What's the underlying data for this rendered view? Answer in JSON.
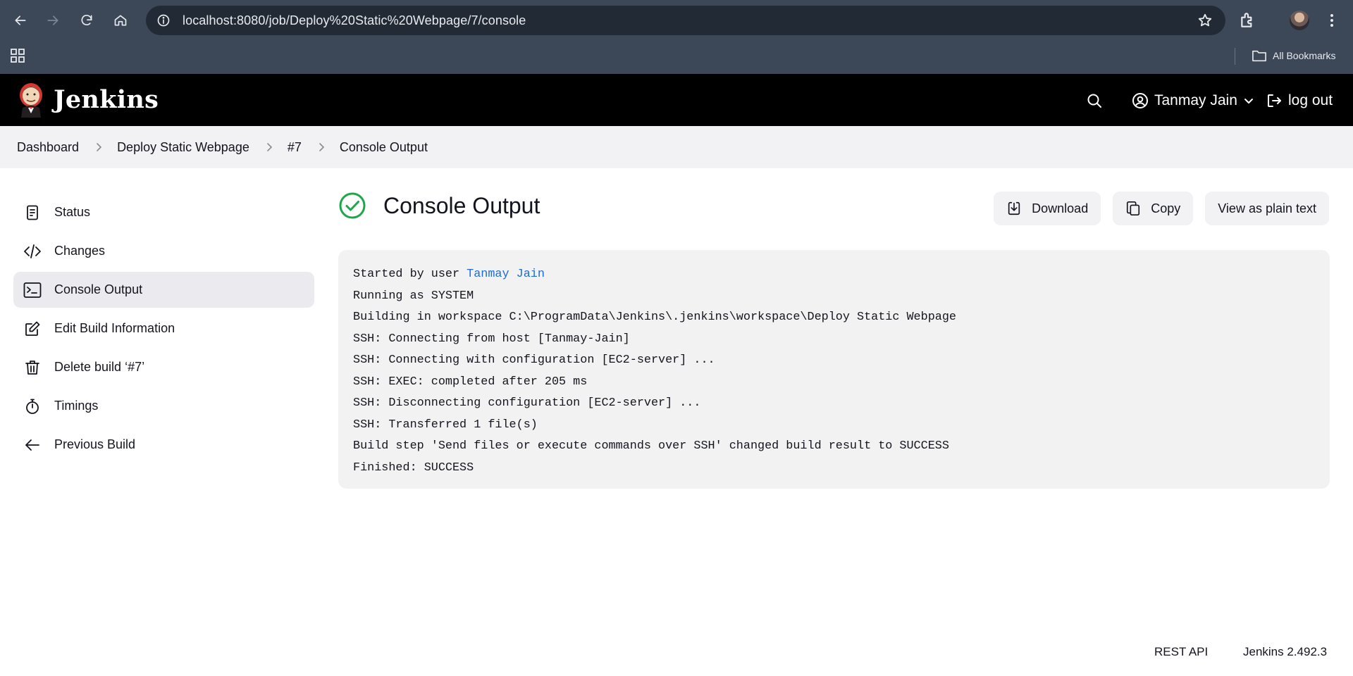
{
  "browser": {
    "url": "localhost:8080/job/Deploy%20Static%20Webpage/7/console",
    "bookmarks_label": "All Bookmarks"
  },
  "header": {
    "app_name": "Jenkins",
    "user_name": "Tanmay Jain",
    "logout_label": "log out"
  },
  "breadcrumb": [
    "Dashboard",
    "Deploy Static Webpage",
    "#7",
    "Console Output"
  ],
  "sidebar": {
    "items": [
      {
        "label": "Status",
        "icon": "document-icon"
      },
      {
        "label": "Changes",
        "icon": "code-icon"
      },
      {
        "label": "Console Output",
        "icon": "terminal-icon",
        "active": true
      },
      {
        "label": "Edit Build Information",
        "icon": "edit-icon"
      },
      {
        "label": "Delete build ‘#7’",
        "icon": "trash-icon"
      },
      {
        "label": "Timings",
        "icon": "stopwatch-icon"
      },
      {
        "label": "Previous Build",
        "icon": "arrow-left-icon"
      }
    ]
  },
  "main": {
    "title": "Console Output",
    "status_color": "#1ea64b",
    "actions": {
      "download": "Download",
      "copy": "Copy",
      "plain_text": "View as plain text"
    },
    "console": {
      "started_prefix": "Started by user ",
      "started_user": "Tanmay Jain",
      "lines": [
        "Running as SYSTEM",
        "Building in workspace C:\\ProgramData\\Jenkins\\.jenkins\\workspace\\Deploy Static Webpage",
        "SSH: Connecting from host [Tanmay-Jain]",
        "SSH: Connecting with configuration [EC2-server] ...",
        "SSH: EXEC: completed after 205 ms",
        "SSH: Disconnecting configuration [EC2-server] ...",
        "SSH: Transferred 1 file(s)",
        "Build step 'Send files or execute commands over SSH' changed build result to SUCCESS",
        "Finished: SUCCESS"
      ]
    }
  },
  "footer": {
    "rest_api": "REST API",
    "version": "Jenkins 2.492.3"
  },
  "colors": {
    "chrome": "#3c4758",
    "header_bg": "#000000",
    "link": "#1d6bd1"
  }
}
